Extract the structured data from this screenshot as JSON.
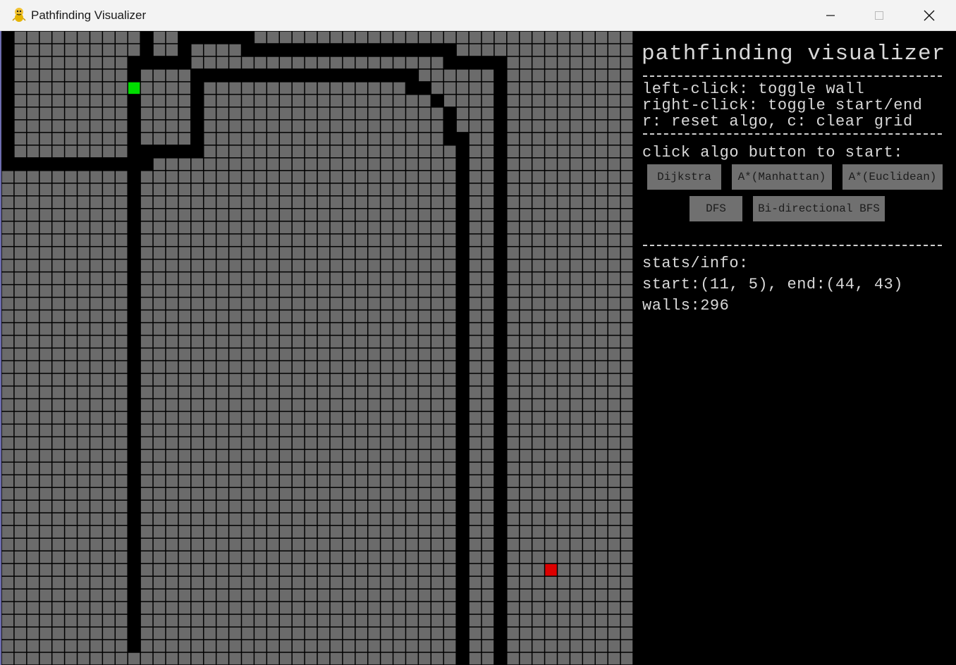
{
  "window": {
    "title": "Pathfinding Visualizer",
    "icon": "python-snake-icon",
    "controls": [
      "minimize-icon",
      "maximize-icon",
      "close-icon"
    ]
  },
  "grid": {
    "rows": 50,
    "cols": 50,
    "colors": {
      "cell": "#6b6b6b",
      "wall": "#000000",
      "start": "#00dd00",
      "end": "#dd0000",
      "line": "#000000"
    },
    "start_cell": [
      10,
      4
    ],
    "end_cell": [
      43,
      42
    ],
    "wall_cells": [
      [
        0,
        10
      ],
      [
        1,
        10
      ],
      [
        2,
        10
      ],
      [
        3,
        10
      ],
      [
        4,
        10
      ],
      [
        5,
        10
      ],
      [
        6,
        10
      ],
      [
        7,
        10
      ],
      [
        8,
        10
      ],
      [
        9,
        10
      ],
      [
        10,
        10
      ],
      [
        11,
        10
      ],
      [
        11,
        9
      ],
      [
        12,
        9
      ],
      [
        13,
        9
      ],
      [
        14,
        9
      ],
      [
        15,
        9
      ],
      [
        15,
        8
      ],
      [
        15,
        7
      ],
      [
        15,
        6
      ],
      [
        15,
        5
      ],
      [
        15,
        4
      ],
      [
        15,
        3
      ],
      [
        16,
        3
      ],
      [
        17,
        3
      ],
      [
        18,
        3
      ],
      [
        19,
        3
      ],
      [
        20,
        3
      ],
      [
        21,
        3
      ],
      [
        22,
        3
      ],
      [
        23,
        3
      ],
      [
        24,
        3
      ],
      [
        25,
        3
      ],
      [
        26,
        3
      ],
      [
        27,
        3
      ],
      [
        28,
        3
      ],
      [
        29,
        3
      ],
      [
        30,
        3
      ],
      [
        31,
        3
      ],
      [
        32,
        3
      ],
      [
        32,
        4
      ],
      [
        33,
        4
      ],
      [
        34,
        5
      ],
      [
        35,
        6
      ],
      [
        35,
        7
      ],
      [
        35,
        8
      ],
      [
        36,
        8
      ],
      [
        36,
        9
      ],
      [
        36,
        10
      ],
      [
        36,
        11
      ],
      [
        36,
        12
      ],
      [
        36,
        13
      ],
      [
        36,
        14
      ],
      [
        36,
        15
      ],
      [
        36,
        16
      ],
      [
        36,
        17
      ],
      [
        36,
        18
      ],
      [
        36,
        19
      ],
      [
        36,
        20
      ],
      [
        36,
        21
      ],
      [
        36,
        22
      ],
      [
        36,
        23
      ],
      [
        36,
        24
      ],
      [
        36,
        25
      ],
      [
        36,
        26
      ],
      [
        36,
        27
      ],
      [
        36,
        28
      ],
      [
        36,
        29
      ],
      [
        36,
        30
      ],
      [
        36,
        31
      ],
      [
        36,
        32
      ],
      [
        36,
        33
      ],
      [
        36,
        34
      ],
      [
        36,
        35
      ],
      [
        36,
        36
      ],
      [
        36,
        37
      ],
      [
        36,
        38
      ],
      [
        36,
        39
      ],
      [
        36,
        40
      ],
      [
        36,
        41
      ],
      [
        36,
        42
      ],
      [
        36,
        43
      ],
      [
        36,
        44
      ],
      [
        36,
        45
      ],
      [
        36,
        46
      ],
      [
        36,
        47
      ],
      [
        36,
        48
      ],
      [
        36,
        49
      ],
      [
        10,
        2
      ],
      [
        10,
        3
      ],
      [
        10,
        4
      ],
      [
        10,
        5
      ],
      [
        10,
        6
      ],
      [
        10,
        7
      ],
      [
        10,
        8
      ],
      [
        10,
        9
      ],
      [
        10,
        11
      ],
      [
        10,
        12
      ],
      [
        10,
        13
      ],
      [
        10,
        14
      ],
      [
        10,
        15
      ],
      [
        10,
        16
      ],
      [
        10,
        17
      ],
      [
        10,
        18
      ],
      [
        10,
        19
      ],
      [
        10,
        20
      ],
      [
        10,
        21
      ],
      [
        10,
        22
      ],
      [
        10,
        23
      ],
      [
        10,
        24
      ],
      [
        10,
        25
      ],
      [
        10,
        26
      ],
      [
        10,
        27
      ],
      [
        10,
        28
      ],
      [
        10,
        29
      ],
      [
        10,
        30
      ],
      [
        10,
        31
      ],
      [
        10,
        32
      ],
      [
        10,
        33
      ],
      [
        10,
        34
      ],
      [
        10,
        35
      ],
      [
        10,
        36
      ],
      [
        10,
        37
      ],
      [
        10,
        38
      ],
      [
        10,
        39
      ],
      [
        10,
        40
      ],
      [
        10,
        41
      ],
      [
        10,
        42
      ],
      [
        10,
        43
      ],
      [
        10,
        44
      ],
      [
        10,
        45
      ],
      [
        10,
        46
      ],
      [
        10,
        47
      ],
      [
        10,
        48
      ],
      [
        11,
        0
      ],
      [
        11,
        1
      ],
      [
        11,
        2
      ],
      [
        12,
        2
      ],
      [
        13,
        2
      ],
      [
        14,
        2
      ],
      [
        14,
        1
      ],
      [
        14,
        0
      ],
      [
        15,
        0
      ],
      [
        16,
        0
      ],
      [
        17,
        0
      ],
      [
        18,
        0
      ],
      [
        19,
        0
      ],
      [
        19,
        1
      ],
      [
        20,
        1
      ],
      [
        21,
        1
      ],
      [
        22,
        1
      ],
      [
        23,
        1
      ],
      [
        24,
        1
      ],
      [
        25,
        1
      ],
      [
        26,
        1
      ],
      [
        27,
        1
      ],
      [
        28,
        1
      ],
      [
        29,
        1
      ],
      [
        30,
        1
      ],
      [
        31,
        1
      ],
      [
        32,
        1
      ],
      [
        33,
        1
      ],
      [
        34,
        1
      ],
      [
        35,
        1
      ],
      [
        35,
        2
      ],
      [
        36,
        2
      ],
      [
        37,
        2
      ],
      [
        38,
        2
      ],
      [
        39,
        2
      ],
      [
        39,
        3
      ],
      [
        39,
        4
      ],
      [
        39,
        5
      ],
      [
        39,
        6
      ],
      [
        39,
        7
      ],
      [
        39,
        8
      ],
      [
        39,
        9
      ],
      [
        39,
        10
      ],
      [
        39,
        11
      ],
      [
        39,
        12
      ],
      [
        39,
        13
      ],
      [
        39,
        14
      ],
      [
        39,
        15
      ],
      [
        39,
        16
      ],
      [
        39,
        17
      ],
      [
        39,
        18
      ],
      [
        39,
        19
      ],
      [
        39,
        20
      ],
      [
        39,
        21
      ],
      [
        39,
        22
      ],
      [
        39,
        23
      ],
      [
        39,
        24
      ],
      [
        39,
        25
      ],
      [
        39,
        26
      ],
      [
        39,
        27
      ],
      [
        39,
        28
      ],
      [
        39,
        29
      ],
      [
        39,
        30
      ],
      [
        39,
        31
      ],
      [
        39,
        32
      ],
      [
        39,
        33
      ],
      [
        39,
        34
      ],
      [
        39,
        35
      ],
      [
        39,
        36
      ],
      [
        39,
        37
      ],
      [
        39,
        38
      ],
      [
        39,
        39
      ],
      [
        39,
        40
      ],
      [
        39,
        41
      ],
      [
        39,
        42
      ],
      [
        39,
        43
      ],
      [
        39,
        44
      ],
      [
        39,
        45
      ],
      [
        39,
        46
      ],
      [
        39,
        47
      ],
      [
        39,
        48
      ],
      [
        39,
        49
      ],
      [
        0,
        0
      ],
      [
        0,
        1
      ],
      [
        0,
        2
      ],
      [
        0,
        3
      ],
      [
        0,
        4
      ],
      [
        0,
        5
      ],
      [
        0,
        6
      ],
      [
        0,
        7
      ],
      [
        0,
        8
      ],
      [
        0,
        9
      ]
    ]
  },
  "panel": {
    "title": "pathfinding visualizer",
    "help_lines": [
      "left-click: toggle wall",
      "right-click: toggle start/end",
      "r: reset algo, c: clear grid"
    ],
    "prompt": "click algo button to start:",
    "buttons": {
      "dijkstra": "Dijkstra",
      "astar_manhattan": "A*(Manhattan)",
      "astar_euclidean": "A*(Euclidean)",
      "dfs": "DFS",
      "bidirectional_bfs": "Bi-directional BFS"
    },
    "stats_header": "stats/info:",
    "start_end": "start:(11, 5), end:(44, 43)",
    "walls": "walls:296"
  }
}
